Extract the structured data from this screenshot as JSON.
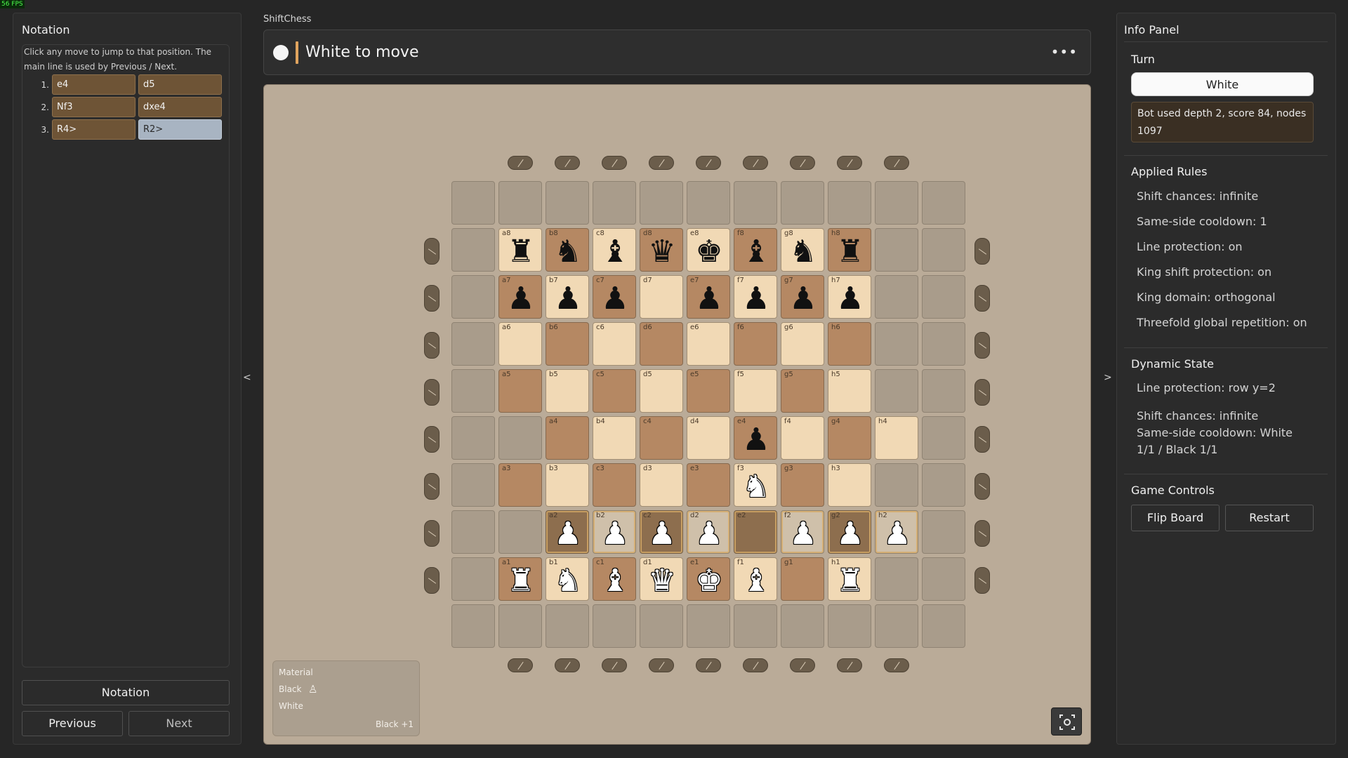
{
  "fps": "56 FPS",
  "app_name": "ShiftChess",
  "header": {
    "turn_text": "White to move",
    "menu_label": "..."
  },
  "notation_panel": {
    "title": "Notation",
    "hint": "Click any move to jump to that position. The main line is used by Previous / Next.",
    "moves": [
      {
        "num": "1.",
        "white": "e4",
        "black": "d5"
      },
      {
        "num": "2.",
        "white": "Nf3",
        "black": "dxe4"
      },
      {
        "num": "3.",
        "white": "R4>",
        "black": "R2>"
      }
    ],
    "notation_button": "Notation",
    "previous_button": "Previous",
    "next_button": "Next"
  },
  "collapse_left": "<",
  "collapse_right": ">",
  "board": {
    "rows": [
      [
        "",
        "",
        "",
        "",
        "",
        "",
        "",
        "",
        "",
        "",
        ""
      ],
      [
        "",
        "a8|♜|b|L",
        "b8|♞|b|D",
        "c8|♝|b|L",
        "d8|♛|b|D",
        "e8|♚|b|L",
        "f8|♝|b|D",
        "g8|♞|b|L",
        "h8|♜|b|D",
        "",
        ""
      ],
      [
        "",
        "a7|♟|b|D",
        "b7|♟|b|L",
        "c7|♟|b|D",
        "d7||b|L",
        "e7|♟|b|D",
        "f7|♟|b|L",
        "g7|♟|b|D",
        "h7|♟|b|L",
        "",
        ""
      ],
      [
        "",
        "a6||b|L",
        "b6||b|D",
        "c6||b|L",
        "d6||b|D",
        "e6||b|L",
        "f6||b|D",
        "g6||b|L",
        "h6||b|D",
        "",
        ""
      ],
      [
        "",
        "a5||b|D",
        "b5||b|L",
        "c5||b|D",
        "d5||b|L",
        "e5||b|D",
        "f5||b|L",
        "g5||b|D",
        "h5||b|L",
        "",
        ""
      ],
      [
        "",
        "",
        "a4||b|D",
        "b4||b|L",
        "c4||b|D",
        "d4||b|L",
        "e4|♟|b|D",
        "f4||b|L",
        "g4||b|D",
        "h4||b|L",
        ""
      ],
      [
        "",
        "a3||b|D",
        "b3||b|L",
        "c3||b|D",
        "d3||b|L",
        "e3||b|D",
        "f3|♞|w|L",
        "g3||b|D",
        "h3||b|L",
        "",
        ""
      ],
      [
        "",
        "",
        "a2|♟|w|DS",
        "b2|♟|w|LS",
        "c2|♟|w|DS",
        "d2|♟|w|LS",
        "e2||b|DS",
        "f2|♟|w|LS",
        "g2|♟|w|DS",
        "h2|♟|w|LS",
        ""
      ],
      [
        "",
        "a1|♜|w|D",
        "b1|♞|w|L",
        "c1|♝|w|D",
        "d1|♛|w|L",
        "e1|♚|w|D",
        "f1|♝|w|L",
        "g1||b|D",
        "h1|♜|w|L",
        "",
        ""
      ],
      [
        "",
        "",
        "",
        "",
        "",
        "",
        "",
        "",
        "",
        "",
        ""
      ]
    ]
  },
  "material": {
    "title": "Material",
    "black_label": "Black",
    "black_icon": "♙",
    "white_label": "White",
    "balance": "Black +1"
  },
  "info_panel": {
    "title": "Info Panel",
    "turn_heading": "Turn",
    "turn_value": "White",
    "bot_info": "Bot used depth 2, score 84, nodes 1097",
    "applied_rules_heading": "Applied Rules",
    "rules": [
      "Shift chances: infinite",
      "Same-side cooldown: 1",
      "Line protection: on",
      "King shift protection: on",
      "King domain: orthogonal",
      "Threefold global repetition: on"
    ],
    "dynamic_state_heading": "Dynamic State",
    "dynamic_line_protection": "Line protection: row y=2",
    "dynamic_shift_chances": "Shift chances: infinite",
    "dynamic_cooldown": "Same-side cooldown: White 1/1 / Black 1/1",
    "game_controls_heading": "Game Controls",
    "flip_board_button": "Flip Board",
    "restart_button": "Restart"
  },
  "colors": {
    "light_square": "#f1d9b5",
    "dark_square": "#b58863",
    "current_move": "#a8b4c2",
    "move_chip": "#6e5436",
    "turn_accent": "#e0a45e"
  },
  "icons": {
    "capture": "screenshot-icon",
    "menu": "more-icon"
  }
}
